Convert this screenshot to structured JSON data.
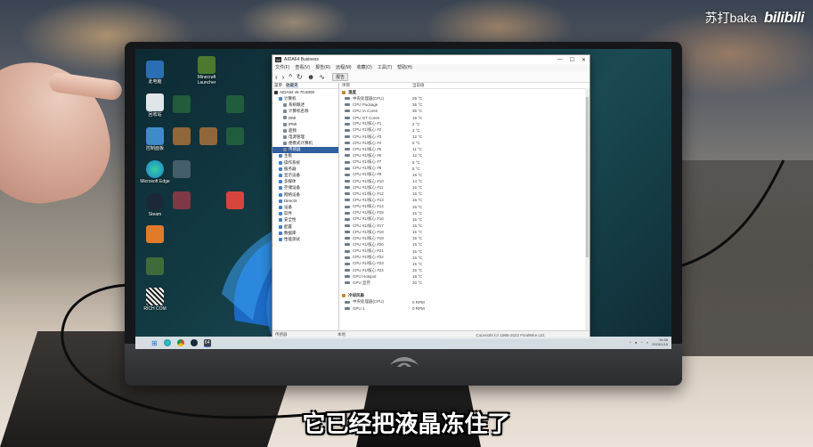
{
  "overlay": {
    "channel": "苏打baka",
    "platform": "bilibili",
    "subtitle": "它已经把液晶冻住了"
  },
  "desktop": {
    "icons": [
      {
        "label": "此电脑"
      },
      {
        "label": "Minecraft Launcher"
      },
      {
        "label": "回收站"
      },
      {
        "label": "控制面板"
      },
      {
        "label": "Microsoft Edge"
      },
      {
        "label": "Steam"
      },
      {
        "label": "RICH COM"
      }
    ]
  },
  "window": {
    "title": "AIDA64 Business",
    "controls": [
      "—",
      "☐",
      "✕"
    ],
    "menu": [
      "文件(F)",
      "查看(V)",
      "报告(R)",
      "远程(M)",
      "收藏(O)",
      "工具(T)",
      "帮助(H)"
    ],
    "toolbar_report": "报告",
    "tree_tabs": [
      "菜单",
      "收藏夹"
    ],
    "tree": [
      {
        "label": "AIDA64 v6.70.6000",
        "indent": 0
      },
      {
        "label": "计算机",
        "indent": 1
      },
      {
        "label": "系统概述",
        "indent": 2
      },
      {
        "label": "计算机名称",
        "indent": 2
      },
      {
        "label": "DMI",
        "indent": 2
      },
      {
        "label": "IPMI",
        "indent": 2
      },
      {
        "label": "超频",
        "indent": 2
      },
      {
        "label": "电源管理",
        "indent": 2
      },
      {
        "label": "便携式计算机",
        "indent": 2
      },
      {
        "label": "传感器",
        "indent": 2,
        "selected": true
      },
      {
        "label": "主板",
        "indent": 1
      },
      {
        "label": "操作系统",
        "indent": 1
      },
      {
        "label": "服务器",
        "indent": 1
      },
      {
        "label": "显示设备",
        "indent": 1
      },
      {
        "label": "多媒体",
        "indent": 1
      },
      {
        "label": "存储设备",
        "indent": 1
      },
      {
        "label": "网络设备",
        "indent": 1
      },
      {
        "label": "DirectX",
        "indent": 1
      },
      {
        "label": "设备",
        "indent": 1
      },
      {
        "label": "软件",
        "indent": 1
      },
      {
        "label": "安全性",
        "indent": 1
      },
      {
        "label": "配置",
        "indent": 1
      },
      {
        "label": "数据库",
        "indent": 1
      },
      {
        "label": "性能测试",
        "indent": 1
      }
    ],
    "columns": [
      "项目",
      "当前值"
    ],
    "rows": [
      {
        "name": "温度",
        "value": "",
        "group": true
      },
      {
        "name": "中央处理器(CPU)",
        "value": "26 °C"
      },
      {
        "name": "CPU Package",
        "value": "35 °C"
      },
      {
        "name": "CPU IA Cores",
        "value": "35 °C"
      },
      {
        "name": "CPU GT Cores",
        "value": "19 °C"
      },
      {
        "name": "CPU #1/核心 #1",
        "value": "2 °C"
      },
      {
        "name": "CPU #1/核心 #2",
        "value": "2 °C"
      },
      {
        "name": "CPU #1/核心 #3",
        "value": "12 °C"
      },
      {
        "name": "CPU #1/核心 #4",
        "value": "5 °C"
      },
      {
        "name": "CPU #1/核心 #5",
        "value": "11 °C"
      },
      {
        "name": "CPU #1/核心 #6",
        "value": "12 °C"
      },
      {
        "name": "CPU #1/核心 #7",
        "value": "5 °C"
      },
      {
        "name": "CPU #1/核心 #8",
        "value": "6 °C"
      },
      {
        "name": "CPU #1/核心 #9",
        "value": "16 °C"
      },
      {
        "name": "CPU #1/核心 #10",
        "value": "14 °C"
      },
      {
        "name": "CPU #1/核心 #11",
        "value": "16 °C"
      },
      {
        "name": "CPU #1/核心 #12",
        "value": "16 °C"
      },
      {
        "name": "CPU #1/核心 #13",
        "value": "15 °C"
      },
      {
        "name": "CPU #1/核心 #14",
        "value": "15 °C"
      },
      {
        "name": "CPU #1/核心 #15",
        "value": "15 °C"
      },
      {
        "name": "CPU #1/核心 #16",
        "value": "15 °C"
      },
      {
        "name": "CPU #1/核心 #17",
        "value": "15 °C"
      },
      {
        "name": "CPU #1/核心 #18",
        "value": "15 °C"
      },
      {
        "name": "CPU #1/核心 #19",
        "value": "15 °C"
      },
      {
        "name": "CPU #1/核心 #20",
        "value": "15 °C"
      },
      {
        "name": "CPU #1/核心 #21",
        "value": "15 °C"
      },
      {
        "name": "CPU #1/核心 #22",
        "value": "15 °C"
      },
      {
        "name": "CPU #1/核心 #23",
        "value": "15 °C"
      },
      {
        "name": "CPU #1/核心 #24",
        "value": "15 °C"
      },
      {
        "name": "GPU Hotspot",
        "value": "18 °C"
      },
      {
        "name": "GPU 显存",
        "value": "20 °C"
      },
      {
        "name": "",
        "value": ""
      },
      {
        "name": "冷却风扇",
        "value": "",
        "group": true
      },
      {
        "name": "中央处理器(CPU)",
        "value": "0 RPM"
      },
      {
        "name": "GPU 1",
        "value": "0 RPM"
      }
    ],
    "status": [
      "传感器",
      "本地",
      "Copyright (c) 1995-2022 FinalWire Ltd."
    ]
  },
  "taskbar": {
    "start_icon": "windows-start-icon",
    "pinned": [
      "edge",
      "chrome",
      "steam",
      "aida64"
    ],
    "aida_label": "64",
    "clock_time": "16:35",
    "clock_date": "2023/1/16"
  },
  "colors": {
    "wallpaper": "#123a43",
    "window_bg": "#ffffff",
    "selection": "#2f5f9e",
    "subtitle": "#ffffff"
  }
}
